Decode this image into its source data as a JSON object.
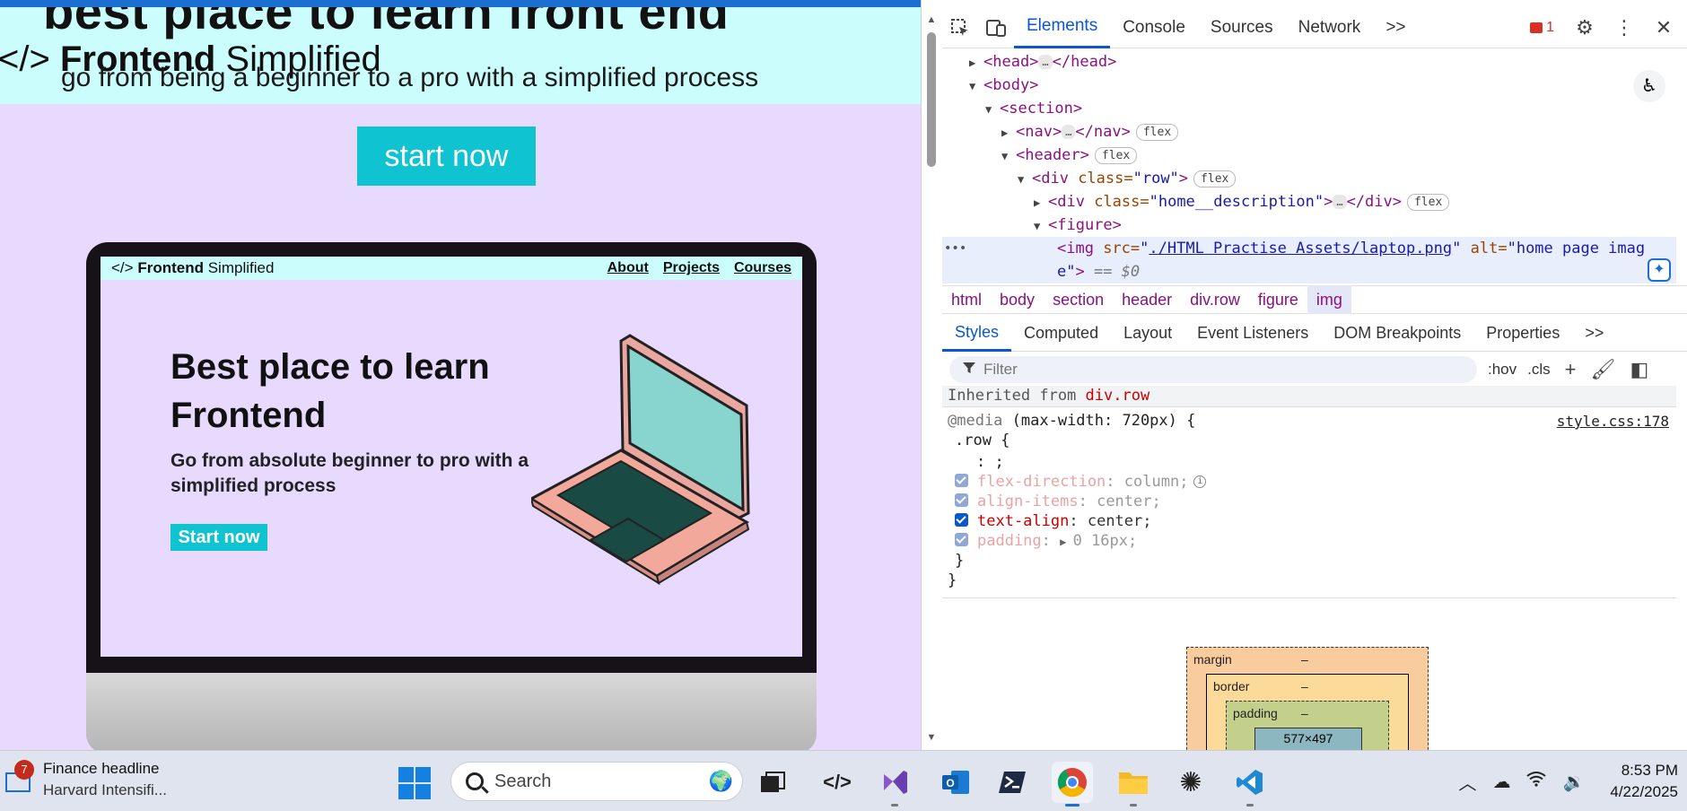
{
  "viewport": {
    "hero_heading": "best place to learn front end",
    "logo_bold": "Frontend",
    "logo_light": "Simplified",
    "logo_glyph": "</>",
    "subtitle": "go from being a beginner to a pro with a simplified process",
    "cta_label": "start now",
    "mockup": {
      "logo_glyph": "</>",
      "logo_bold": "Frontend",
      "logo_light": "Simplified",
      "nav_links": [
        "About",
        "Projects",
        "Courses"
      ],
      "title": "Best place to learn Frontend",
      "description": "Go from absolute beginner to pro with a simplified process",
      "button_label": "Start now"
    }
  },
  "devtools": {
    "toolbar": {
      "tabs": [
        "Elements",
        "Console",
        "Sources",
        "Network"
      ],
      "active_tab": "Elements",
      "more": ">>",
      "error_count": "1"
    },
    "dom_tree": {
      "head_open": "<head>",
      "head_close": "</head>",
      "body": "<body>",
      "section": "<section>",
      "nav_open": "<nav>",
      "nav_close": "</nav>",
      "header": "<header>",
      "div_row_open": "<div ",
      "div_row_attr": "class=",
      "div_row_val": "\"row\"",
      "div_row_close": ">",
      "div_desc_open": "<div ",
      "div_desc_attr": "class=",
      "div_desc_val": "\"home__description\"",
      "div_desc_close": ">",
      "div_desc_end": "</div>",
      "figure": "<figure>",
      "img_open": "<img ",
      "img_src_attr": "src=",
      "img_src_quote_open": "\"",
      "img_src_val": "./HTML Practise Assets/laptop.png",
      "img_src_quote_close": "\"",
      "img_alt_attr": " alt=",
      "img_alt_val": "\"home page imag",
      "img_alt_val2": "e\"",
      "img_close": ">",
      "img_eq": " == $0",
      "ellipsis": "…",
      "badge_flex": "flex",
      "gutter_dots": "•••"
    },
    "breadcrumbs": [
      "html",
      "body",
      "section",
      "header",
      "div.row",
      "figure",
      "img"
    ],
    "sub_tabs": [
      "Styles",
      "Computed",
      "Layout",
      "Event Listeners",
      "DOM Breakpoints",
      "Properties"
    ],
    "sub_tabs_more": ">>",
    "filter_placeholder": "Filter",
    "filter_buttons": [
      ":hov",
      ".cls"
    ],
    "styles": {
      "inherited_label": "Inherited from ",
      "inherited_from": "div.row",
      "media_rule": "@media",
      "media_query": " (max-width: 720px) {",
      "selector": ".row {",
      "empty_decl": ": ;",
      "source_link": "style.css:178",
      "declarations": [
        {
          "prop": "flex-direction",
          "value": "column;",
          "enabled": false
        },
        {
          "prop": "align-items",
          "value": "center;",
          "enabled": false
        },
        {
          "prop": "text-align",
          "value": "center;",
          "enabled": true
        },
        {
          "prop": "padding",
          "value": "0 16px;",
          "enabled": false
        }
      ],
      "close_inner": "}",
      "close_outer": "}"
    },
    "box_model": {
      "margin_label": "margin",
      "border_label": "border",
      "padding_label": "padding",
      "dash": "–",
      "content_size": "577×497"
    }
  },
  "taskbar": {
    "widget_badge": "7",
    "widget_title": "Finance headline",
    "widget_subtitle": "Harvard Intensifi...",
    "search_placeholder": "Search",
    "time": "8:53 PM",
    "date": "4/22/2025",
    "apps": [
      "task-view",
      "devtools",
      "visual-studio",
      "outlook",
      "terminal",
      "chrome",
      "file-explorer",
      "chatgpt",
      "vscode"
    ],
    "active_app": "chrome",
    "accent": "#1a6fd0"
  }
}
